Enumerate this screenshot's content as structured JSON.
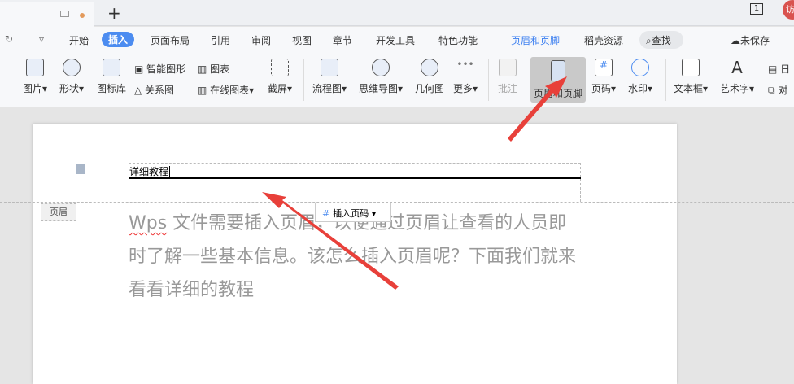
{
  "tabbar": {
    "new_tab": "+",
    "page_indicator": "1",
    "avatar": "访"
  },
  "menu": {
    "items": [
      "开始",
      "插入",
      "页面布局",
      "引用",
      "审阅",
      "视图",
      "章节",
      "开发工具",
      "特色功能",
      "页眉和页脚",
      "稻壳资源"
    ],
    "search": "查找",
    "unsaved": "未保存"
  },
  "ribbon": {
    "picture": "图片",
    "shape": "形状",
    "icon_lib": "图标库",
    "smart_art": "智能图形",
    "relation": "关系图",
    "chart": "图表",
    "online_chart": "在线图表",
    "screenshot": "截屏",
    "flowchart": "流程图",
    "mindmap": "思维导图",
    "geometry": "几何图",
    "more": "更多",
    "comment": "批注",
    "header_footer": "页眉和页脚",
    "page_number": "页码",
    "watermark": "水印",
    "textbox": "文本框",
    "wordart": "艺术字",
    "date": "日",
    "align": "对"
  },
  "document": {
    "header_text": "详细教程",
    "header_label": "页眉",
    "insert_page_number": "插入页码",
    "body_wps": "Wps",
    "body_rest": " 文件需要插入页眉，以便通过页眉让查看的人员即时了解一些基本信息。该怎么插入页眉呢？下面我们就来看看详细的教程"
  },
  "colors": {
    "accent": "#4c8cf0",
    "arrow": "#e8403a"
  }
}
